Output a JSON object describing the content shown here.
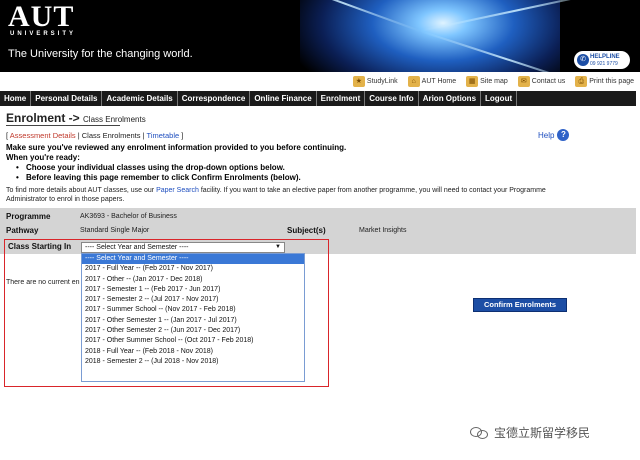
{
  "banner": {
    "logo": "AUT",
    "logo_sub": "UNIVERSITY",
    "tagline": "The University for the changing world.",
    "helpline_title": "HELPLINE",
    "helpline_number": "09 921 9779"
  },
  "util_links": [
    {
      "label": "StudyLink",
      "icon": "studylink-icon"
    },
    {
      "label": "AUT Home",
      "icon": "home-icon"
    },
    {
      "label": "Site map",
      "icon": "sitemap-icon"
    },
    {
      "label": "Contact us",
      "icon": "contact-icon"
    },
    {
      "label": "Print this page",
      "icon": "print-icon"
    }
  ],
  "nav": [
    "Home",
    "Personal Details",
    "Academic Details",
    "Correspondence",
    "Online Finance",
    "Enrolment",
    "Course Info",
    "Arion Options",
    "Logout"
  ],
  "page": {
    "title": "Enrolment ->",
    "title_sub": "Class Enrolments",
    "help": "Help"
  },
  "crumbs": {
    "assessment": "Assessment Details",
    "current": "Class Enrolments",
    "timetable": "Timetable"
  },
  "instructions": {
    "line1": "Make sure you've reviewed any enrolment information provided to you before continuing.",
    "line2": "When you're ready:",
    "bullet1": "Choose your individual classes using the drop-down options below.",
    "bullet2": "Before leaving this page remember to click Confirm Enrolments (below)."
  },
  "info": {
    "pre": "To find more details about AUT classes, use our ",
    "link": "Paper Search",
    "post": " facility. If you want to take an elective paper from another programme, you will need to contact your Programme Administrator to enrol in those papers."
  },
  "programme": {
    "programme_label": "Programme",
    "programme_value": "AK3693 - Bachelor of Business",
    "pathway_label": "Pathway",
    "pathway_value": "Standard Single Major",
    "subjects_label": "Subject(s)",
    "subjects_value": "Market Insights",
    "class_start_label": "Class Starting In"
  },
  "select": {
    "value": "---- Select Year and Semester ----",
    "options": [
      "---- Select Year and Semester ----",
      "2017 - Full Year -- (Feb 2017 - Nov 2017)",
      "2017 - Other -- (Jan 2017 - Dec 2018)",
      "2017 - Semester 1 -- (Feb 2017 - Jun 2017)",
      "2017 - Semester 2 -- (Jul 2017 - Nov 2017)",
      "2017 - Summer School -- (Nov 2017 - Feb 2018)",
      "2017 - Other Semester 1 -- (Jan 2017 - Jul 2017)",
      "2017 - Other Semester 2 -- (Jun 2017 - Dec 2017)",
      "2017 - Other Summer School -- (Oct 2017 - Feb 2018)",
      "2018 - Full Year -- (Feb 2018 - Nov 2018)",
      "2018 - Semester 2 -- (Jul 2018 - Nov 2018)"
    ]
  },
  "no_current": "There are no current enrolments",
  "confirm_label": "Confirm Enrolments",
  "watermark": "宝德立斯留学移民",
  "colors": {
    "nav_bg": "#1a1a1a",
    "accent_blue": "#1c4ea5",
    "highlight_red": "#d9252a",
    "table_bg": "#d4d4d4",
    "selected_option": "#3a78d6"
  }
}
